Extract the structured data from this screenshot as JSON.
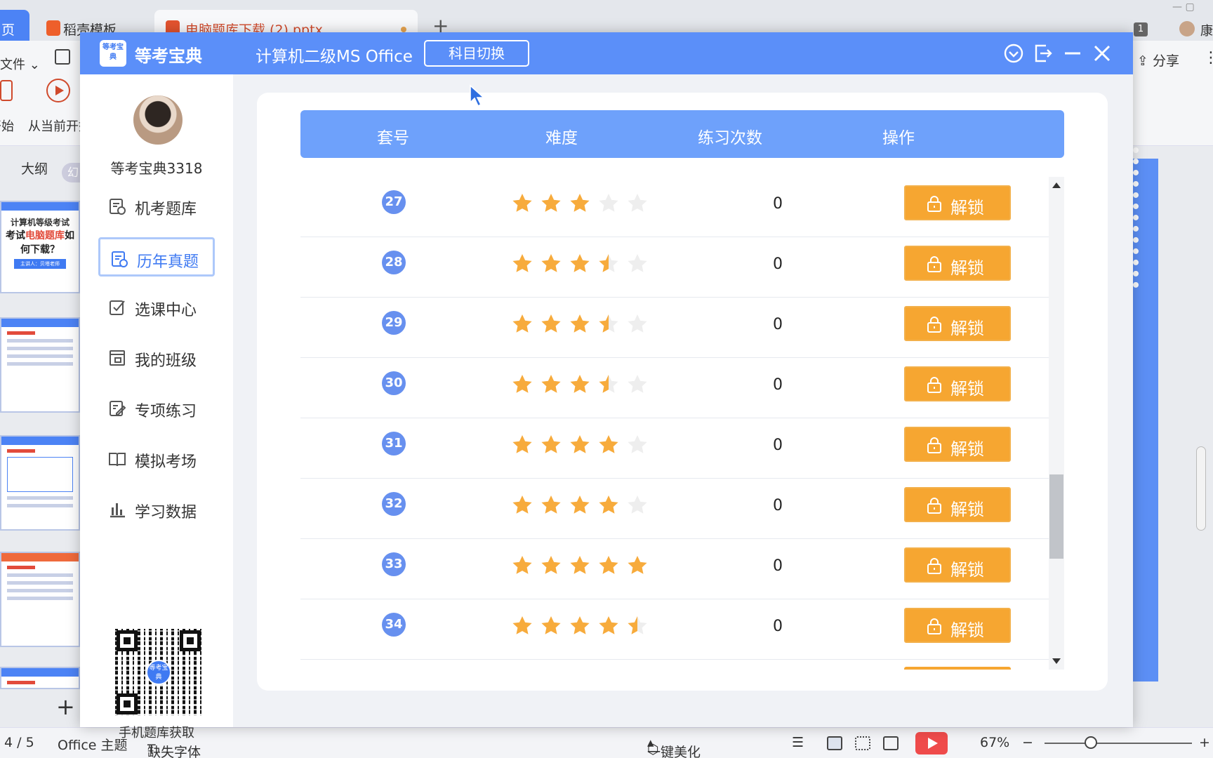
{
  "wps": {
    "tabs": [
      "页",
      "稻壳模板",
      "电脑题库下载 (2).pptx"
    ],
    "tab_badge": "1",
    "user_initial": "康",
    "file_menu": "文件",
    "start_label_a": "开始",
    "start_label_b": "从当前开始",
    "share": "分享",
    "outline_tab": "大纲",
    "outline_tab2": "幻",
    "slide_thumb": {
      "title": "计算机等级考试",
      "line1a": "考试",
      "line1b": "电脑题库",
      "line1c": "如",
      "line2": "何下载？",
      "btn": "主讲人：贝塔老师"
    },
    "status": {
      "page": "4 / 5",
      "theme": "Office 主题",
      "missing_font": "缺失字体",
      "beautify": "一键美化",
      "zoom": "67%"
    }
  },
  "app": {
    "name": "等考宝典",
    "logo_text": "等考宝典",
    "subject": "计算机二级MS Office",
    "switch_button": "科目切换",
    "header_icons": [
      "dropdown-icon",
      "exit-icon",
      "minimize-icon",
      "close-icon"
    ],
    "username": "等考宝典3318",
    "nav": [
      {
        "label": "机考题库",
        "icon": "exam-bank-icon"
      },
      {
        "label": "历年真题",
        "icon": "past-papers-icon",
        "active": true
      },
      {
        "label": "选课中心",
        "icon": "course-check-icon"
      },
      {
        "label": "我的班级",
        "icon": "class-icon"
      },
      {
        "label": "专项练习",
        "icon": "edit-practice-icon"
      },
      {
        "label": "模拟考场",
        "icon": "book-icon"
      },
      {
        "label": "学习数据",
        "icon": "bar-chart-icon"
      }
    ],
    "qr_caption": "手机题库获取",
    "qr_logo": "等考宝典",
    "table": {
      "headers": [
        "套号",
        "难度",
        "练习次数",
        "操作"
      ],
      "rows": [
        {
          "num": "27",
          "difficulty": 3,
          "count": "0",
          "action": "解锁"
        },
        {
          "num": "28",
          "difficulty": 3.5,
          "count": "0",
          "action": "解锁"
        },
        {
          "num": "29",
          "difficulty": 3.5,
          "count": "0",
          "action": "解锁"
        },
        {
          "num": "30",
          "difficulty": 3.5,
          "count": "0",
          "action": "解锁"
        },
        {
          "num": "31",
          "difficulty": 4,
          "count": "0",
          "action": "解锁"
        },
        {
          "num": "32",
          "difficulty": 4,
          "count": "0",
          "action": "解锁"
        },
        {
          "num": "33",
          "difficulty": 5,
          "count": "0",
          "action": "解锁"
        },
        {
          "num": "34",
          "difficulty": 4.5,
          "count": "0",
          "action": "解锁"
        }
      ]
    },
    "colors": {
      "header": "#5b8ff9",
      "table_header": "#6ea1fb",
      "unlock": "#f6a631",
      "star": "#f7ab3c",
      "star_empty": "#eeeeee"
    }
  }
}
